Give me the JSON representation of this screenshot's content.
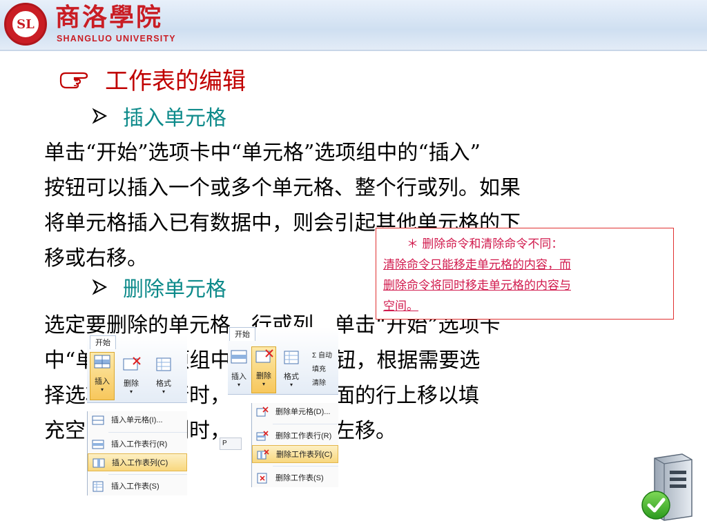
{
  "header": {
    "seal_letters": "SL",
    "university_cn": "商洛學院",
    "university_en": "SHANGLUO UNIVERSITY"
  },
  "title": {
    "text": "工作表的编辑",
    "icon": "pointing-hand-icon"
  },
  "section1": {
    "heading": "插入单元格",
    "lines": [
      "单击“开始”选项卡中“单元格”选项组中的“插入”",
      "按钮可以插入一个或多个单元格、整个行或列。如果",
      "将单元格插入已有数据中，则会引起其他单元格的下",
      "移或右移。"
    ]
  },
  "section2": {
    "heading": "删除单元格",
    "lines": [
      "选定要删除的单元格、行或列，单击“开始”选项卡",
      "中“单元格”选项组中的“删除”按钮，根据需要选",
      "择选项。删除行时，所删除行下面的行上移以填",
      "充空间；删除列时，右边的列向左移。"
    ]
  },
  "note": {
    "line1": "＊ 删除命令和清除命令不同：",
    "line2": "清除命令只能移走单元格的内容，而",
    "line3": "删除命令将同时移走单元格的内容与",
    "line4": "空间。",
    "color": "#d11a4d"
  },
  "insert_shot": {
    "tab": "开始",
    "buttons": [
      "插入",
      "删除",
      "格式"
    ],
    "menu": [
      "插入单元格(I)...",
      "插入工作表行(R)",
      "插入工作表列(C)",
      "插入工作表(S)"
    ]
  },
  "delete_shot": {
    "tab": "开始",
    "buttons": [
      "插入",
      "删除",
      "格式"
    ],
    "side": [
      "Σ 自动",
      "填充",
      "清除"
    ],
    "cell_ref": "P",
    "menu": [
      "删除单元格(D)...",
      "删除工作表行(R)",
      "删除工作表列(C)",
      "删除工作表(S)"
    ]
  },
  "colors": {
    "title": "#c00000",
    "subheading": "#0d8a8a",
    "brand": "#c91d24"
  }
}
